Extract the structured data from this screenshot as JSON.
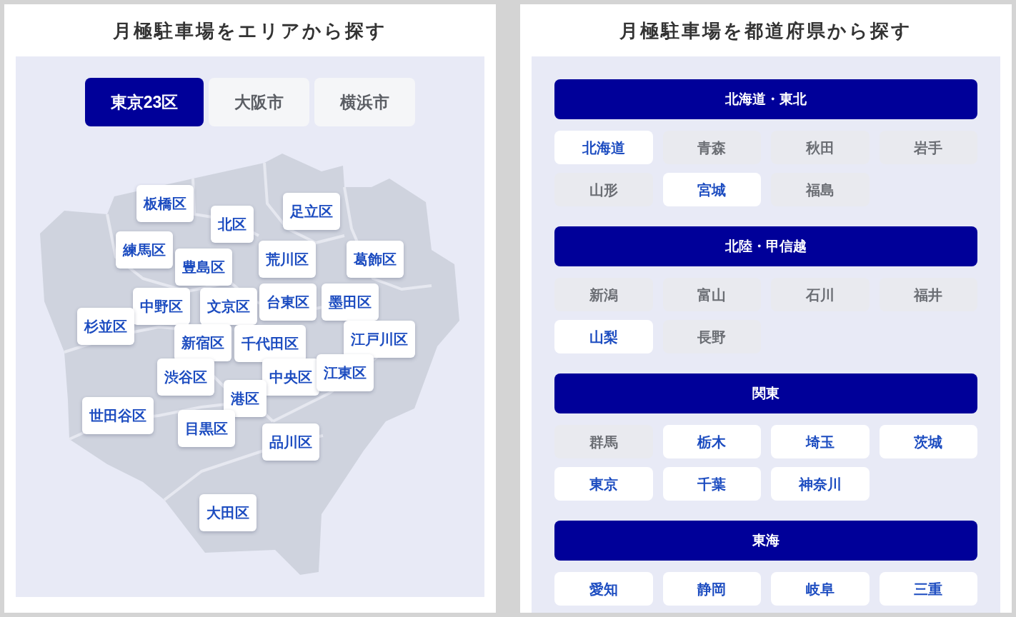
{
  "area_panel": {
    "title": "月極駐車場をエリアから探す",
    "tabs": [
      {
        "label": "東京23区",
        "selected": true
      },
      {
        "label": "大阪市",
        "selected": false
      },
      {
        "label": "横浜市",
        "selected": false
      }
    ],
    "map": {
      "districts": [
        {
          "label": "板橋区"
        },
        {
          "label": "北区"
        },
        {
          "label": "足立区"
        },
        {
          "label": "練馬区"
        },
        {
          "label": "豊島区"
        },
        {
          "label": "荒川区"
        },
        {
          "label": "葛飾区"
        },
        {
          "label": "中野区"
        },
        {
          "label": "文京区"
        },
        {
          "label": "台東区"
        },
        {
          "label": "墨田区"
        },
        {
          "label": "杉並区"
        },
        {
          "label": "新宿区"
        },
        {
          "label": "千代田区"
        },
        {
          "label": "江戸川区"
        },
        {
          "label": "渋谷区"
        },
        {
          "label": "中央区"
        },
        {
          "label": "江東区"
        },
        {
          "label": "港区"
        },
        {
          "label": "世田谷区"
        },
        {
          "label": "目黒区"
        },
        {
          "label": "品川区"
        },
        {
          "label": "大田区"
        }
      ]
    }
  },
  "prefecture_panel": {
    "title": "月極駐車場を都道府県から探す",
    "regions": [
      {
        "header": "北海道・東北",
        "prefectures": [
          {
            "label": "北海道",
            "disabled": false
          },
          {
            "label": "青森",
            "disabled": true
          },
          {
            "label": "秋田",
            "disabled": true
          },
          {
            "label": "岩手",
            "disabled": true
          },
          {
            "label": "山形",
            "disabled": true
          },
          {
            "label": "宮城",
            "disabled": false
          },
          {
            "label": "福島",
            "disabled": true
          }
        ]
      },
      {
        "header": "北陸・甲信越",
        "prefectures": [
          {
            "label": "新潟",
            "disabled": true
          },
          {
            "label": "富山",
            "disabled": true
          },
          {
            "label": "石川",
            "disabled": true
          },
          {
            "label": "福井",
            "disabled": true
          },
          {
            "label": "山梨",
            "disabled": false
          },
          {
            "label": "長野",
            "disabled": true
          }
        ]
      },
      {
        "header": "関東",
        "prefectures": [
          {
            "label": "群馬",
            "disabled": true
          },
          {
            "label": "栃木",
            "disabled": false
          },
          {
            "label": "埼玉",
            "disabled": false
          },
          {
            "label": "茨城",
            "disabled": false
          },
          {
            "label": "東京",
            "disabled": false
          },
          {
            "label": "千葉",
            "disabled": false
          },
          {
            "label": "神奈川",
            "disabled": false
          }
        ]
      },
      {
        "header": "東海",
        "prefectures": [
          {
            "label": "愛知",
            "disabled": false
          },
          {
            "label": "静岡",
            "disabled": false
          },
          {
            "label": "岐阜",
            "disabled": false
          },
          {
            "label": "三重",
            "disabled": false
          }
        ]
      }
    ]
  }
}
